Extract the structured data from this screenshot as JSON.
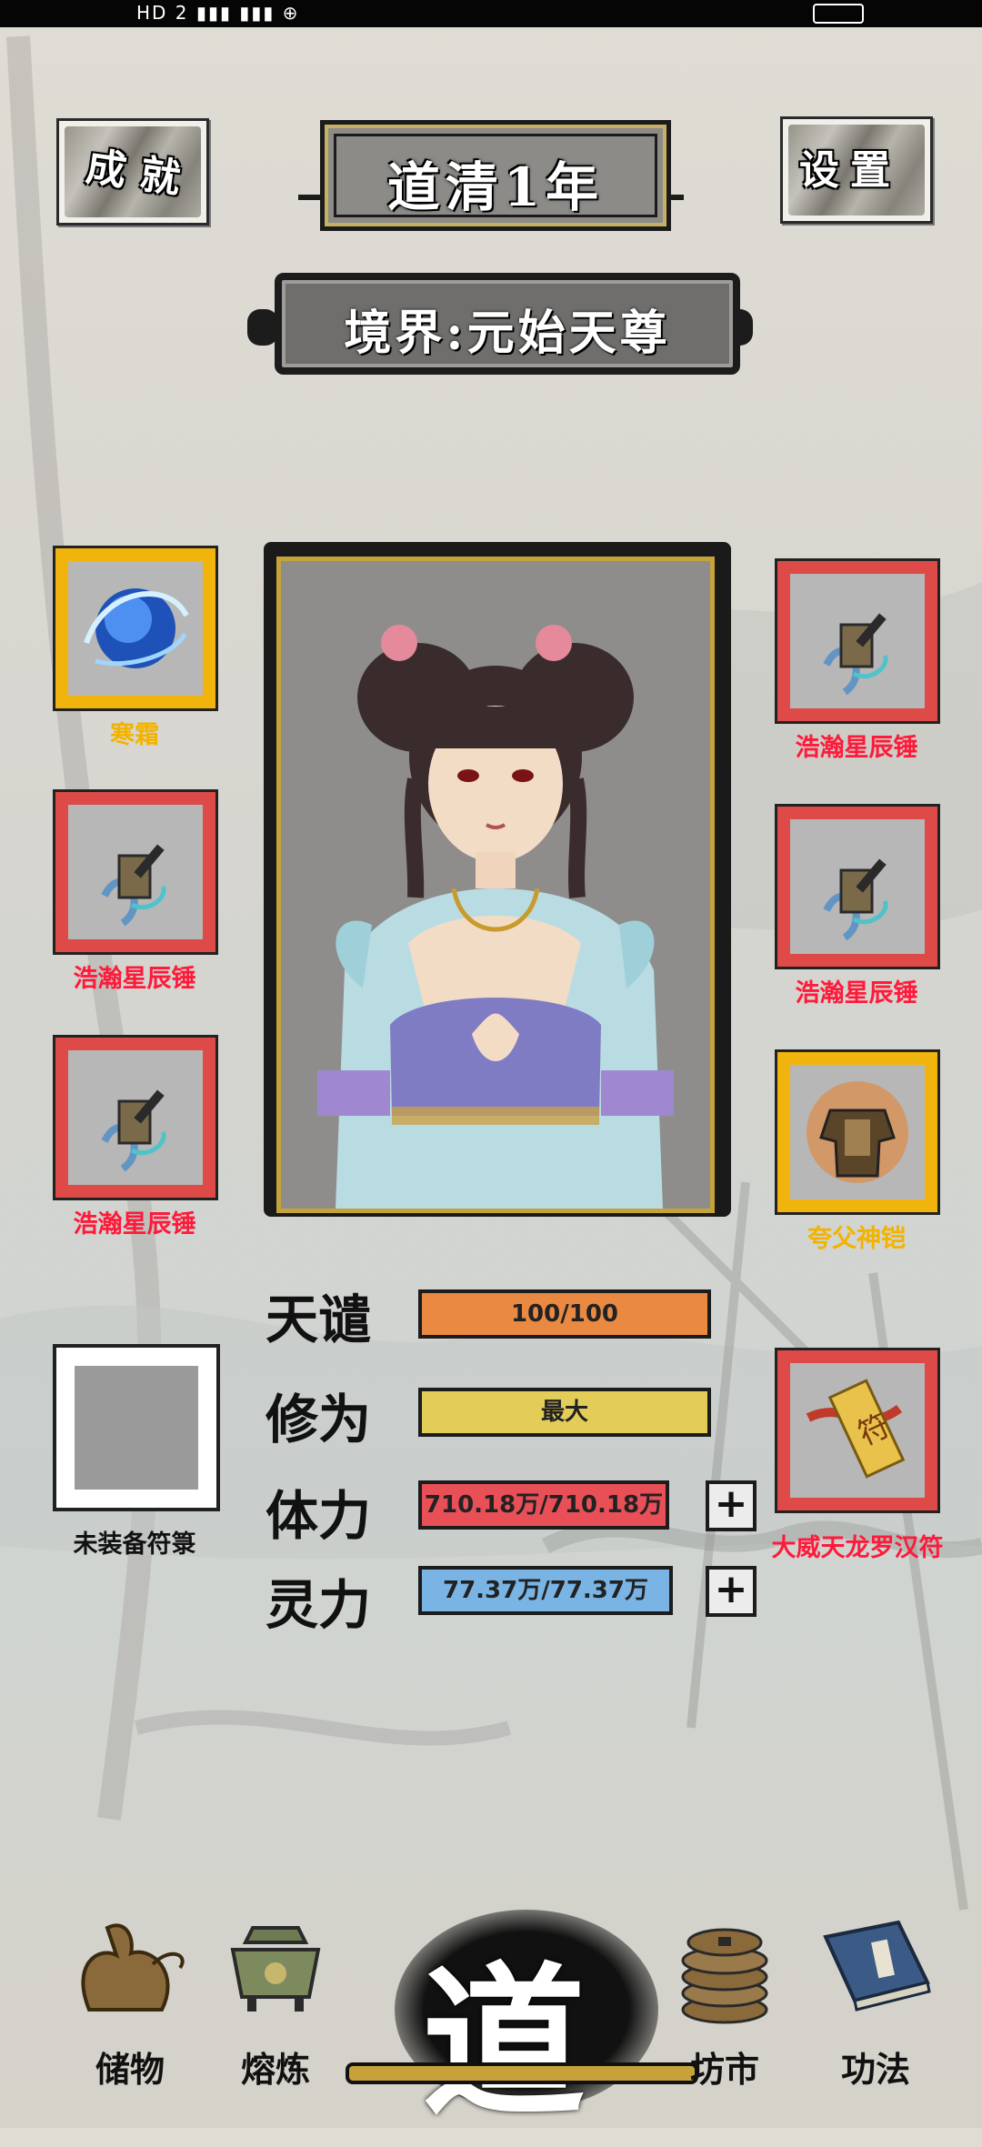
{
  "status_bar": {
    "left_text": "HD 2  ▮▮▮  ▮▮▮  ⊕"
  },
  "header": {
    "achievement_label": "成就",
    "settings_label": "设置",
    "year_title": "道清1年",
    "realm_text": "境界:元始天尊"
  },
  "left_slots": [
    {
      "name": "寒霜",
      "rarity": "gold",
      "icon": "frost-orb-icon"
    },
    {
      "name": "浩瀚星辰锤",
      "rarity": "red",
      "icon": "hammer-icon"
    },
    {
      "name": "浩瀚星辰锤",
      "rarity": "red",
      "icon": "hammer-icon"
    }
  ],
  "right_slots": [
    {
      "name": "浩瀚星辰锤",
      "rarity": "red",
      "icon": "hammer-icon"
    },
    {
      "name": "浩瀚星辰锤",
      "rarity": "red",
      "icon": "hammer-icon"
    },
    {
      "name": "夸父神铠",
      "rarity": "gold",
      "icon": "armor-icon"
    }
  ],
  "talisman_slot": {
    "name": "未装备符箓"
  },
  "right_talisman": {
    "name": "大威天龙罗汉符",
    "icon": "talisman-icon"
  },
  "stats": [
    {
      "label": "天谴",
      "value": "100/100",
      "color": "#ea8a42"
    },
    {
      "label": "修为",
      "value": "最大",
      "color": "#e4cc58"
    },
    {
      "label": "体力",
      "value": "710.18万/710.18万",
      "color": "#e94f57"
    },
    {
      "label": "灵力",
      "value": "77.37万/77.37万",
      "color": "#7ab4e4"
    }
  ],
  "nav": {
    "storage": "储物",
    "smelting": "熔炼",
    "center": "道",
    "market": "坊市",
    "techniques": "功法"
  },
  "colors": {
    "red_slot": "#dd4a47",
    "gold_slot": "#f1b40c",
    "frame_gold": "#c4a43a"
  }
}
